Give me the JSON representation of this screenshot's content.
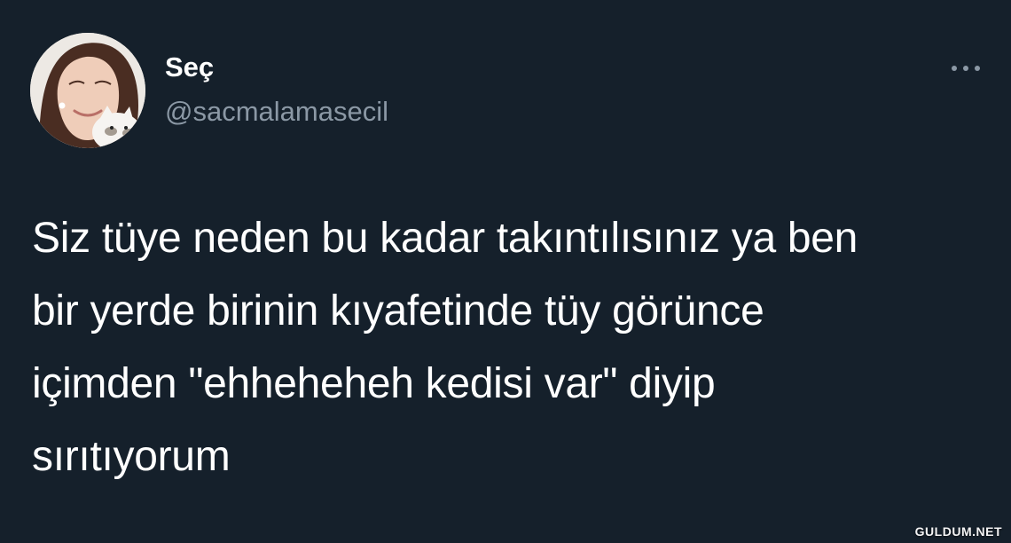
{
  "colors": {
    "background": "#15202b",
    "primary_text": "#ffffff",
    "secondary_text": "#8b98a5"
  },
  "author": {
    "display_name": "Seç",
    "handle": "@sacmalamasecil",
    "avatar_icon": "profile-photo"
  },
  "tweet": {
    "lines": [
      "Siz tüye neden bu kadar takıntılısınız ya ben",
      "bir yerde birinin kıyafetinde tüy görünce",
      "içimden \"ehheheheh kedisi var\" diyip",
      "sırıtıyorum"
    ]
  },
  "actions": {
    "more_icon": "more-horizontal-icon"
  },
  "watermark": "GULDUM.NET"
}
